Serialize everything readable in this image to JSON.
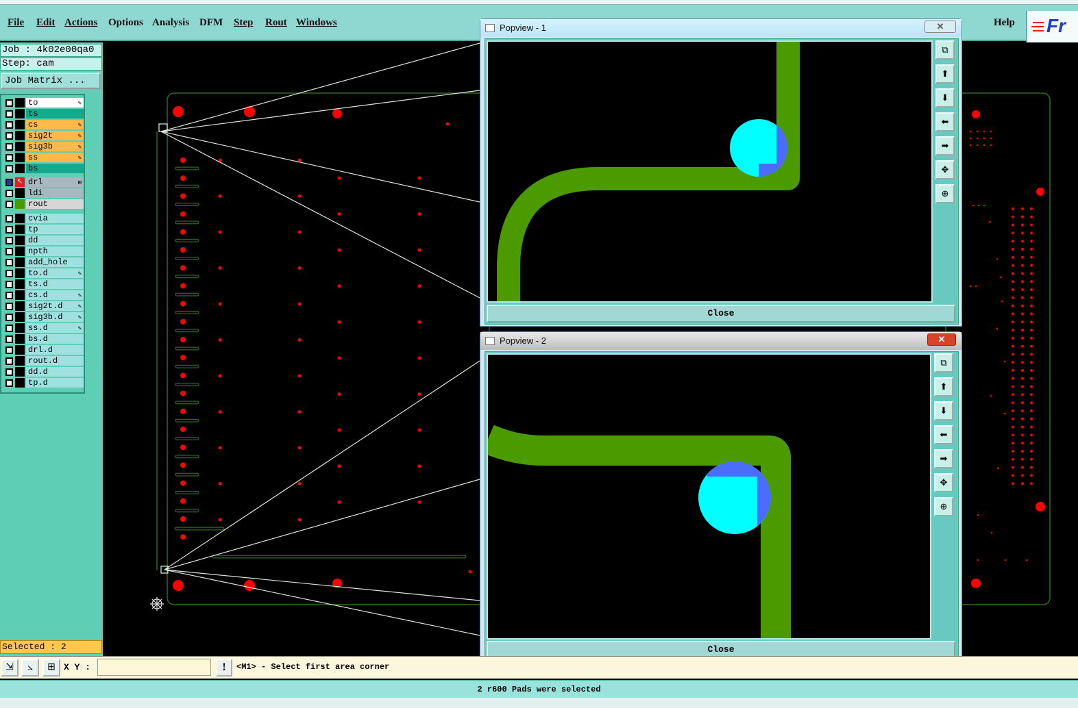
{
  "menu": {
    "items": [
      "File",
      "Edit",
      "Actions",
      "Options",
      "Analysis",
      "DFM",
      "Step",
      "Rout",
      "Windows"
    ],
    "help": "Help",
    "logo_text": "Fr"
  },
  "job": {
    "job_label": "Job : 4k02e00qa0",
    "step_label": "Step: cam",
    "matrix_button": "Job Matrix ..."
  },
  "layers": [
    {
      "name": "to",
      "color": "#ffffff",
      "editable": true
    },
    {
      "name": "ts",
      "color": "#12a98c",
      "editable": false
    },
    {
      "name": "cs",
      "color": "#ffb84a",
      "editable": true
    },
    {
      "name": "sig2t",
      "color": "#ffb84a",
      "editable": true
    },
    {
      "name": "sig3b",
      "color": "#ffb84a",
      "editable": true
    },
    {
      "name": "ss",
      "color": "#ffb84a",
      "editable": true
    },
    {
      "name": "bs",
      "color": "#12a98c",
      "editable": false
    },
    {
      "name": "drl",
      "color": "#a8b8c0",
      "editable": false
    },
    {
      "name": "ldi",
      "color": "#a8b8c0",
      "editable": false
    },
    {
      "name": "rout",
      "color": "#d6d6d6",
      "editable": false
    },
    {
      "name": "cvia",
      "color": "#9fe0e0",
      "editable": false
    },
    {
      "name": "tp",
      "color": "#9fe0e0",
      "editable": false
    },
    {
      "name": "dd",
      "color": "#9fe0e0",
      "editable": false
    },
    {
      "name": "npth",
      "color": "#9fe0e0",
      "editable": false
    },
    {
      "name": "add_hole",
      "color": "#9fe0e0",
      "editable": false
    },
    {
      "name": "to.d",
      "color": "#9fe0e0",
      "editable": true
    },
    {
      "name": "ts.d",
      "color": "#9fe0e0",
      "editable": false
    },
    {
      "name": "cs.d",
      "color": "#9fe0e0",
      "editable": true
    },
    {
      "name": "sig2t.d",
      "color": "#9fe0e0",
      "editable": true
    },
    {
      "name": "sig3b.d",
      "color": "#9fe0e0",
      "editable": true
    },
    {
      "name": "ss.d",
      "color": "#9fe0e0",
      "editable": true
    },
    {
      "name": "bs.d",
      "color": "#9fe0e0",
      "editable": false
    },
    {
      "name": "drl.d",
      "color": "#9fe0e0",
      "editable": false
    },
    {
      "name": "rout.d",
      "color": "#9fe0e0",
      "editable": false
    },
    {
      "name": "dd.d",
      "color": "#9fe0e0",
      "editable": false
    },
    {
      "name": "tp.d",
      "color": "#9fe0e0",
      "editable": false
    }
  ],
  "selected_label": "Selected : 2",
  "status": {
    "xy_label": "X Y :",
    "xy_value": "",
    "warn_icon": "!",
    "prompt": "<M1> - Select first area corner",
    "message": "2 r600 Pads were selected"
  },
  "popview1": {
    "title": "Popview - 1",
    "close_label": "Close"
  },
  "popview2": {
    "title": "Popview - 2",
    "close_label": "Close"
  },
  "colors": {
    "trace": "#4a9a00",
    "pad": "#00ffff",
    "pad_highlight": "#4b6cff",
    "drill": "#ff0000",
    "outline": "#2f6a1f"
  }
}
